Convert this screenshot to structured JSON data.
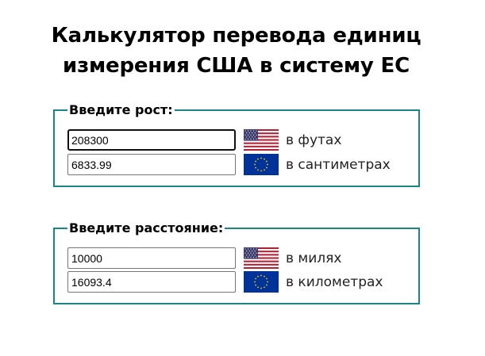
{
  "title": "Калькулятор перевода единиц измерения США в систему ЕС",
  "height_group": {
    "legend": "Введите рост:",
    "rows": [
      {
        "value": "208300",
        "flag": "us-flag-icon",
        "unit": "в футах"
      },
      {
        "value": "6833.99",
        "flag": "eu-flag-icon",
        "unit": "в сантиметрах"
      }
    ]
  },
  "distance_group": {
    "legend": "Введите расстояние:",
    "rows": [
      {
        "value": "10000",
        "flag": "us-flag-icon",
        "unit": "в милях"
      },
      {
        "value": "16093.4",
        "flag": "eu-flag-icon",
        "unit": "в километрах"
      }
    ]
  },
  "colors": {
    "fieldset_border": "#1a8585",
    "us_red": "#b22234",
    "us_blue": "#3c3b6e",
    "eu_blue": "#003399",
    "eu_gold": "#ffcc00"
  }
}
